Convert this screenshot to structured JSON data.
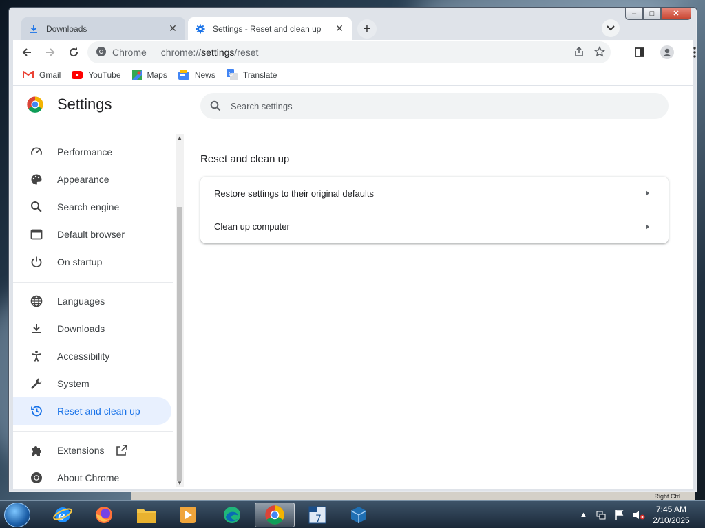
{
  "window": {
    "caption_minimize": "–",
    "caption_maximize": "□",
    "caption_close": "✕"
  },
  "tabs": [
    {
      "title": "Downloads",
      "icon": "download-icon",
      "close": "✕"
    },
    {
      "title": "Settings - Reset and clean up",
      "icon": "gear-icon",
      "close": "✕"
    }
  ],
  "new_tab": "+",
  "toolbar": {
    "site_label": "Chrome",
    "url_host": "chrome://",
    "url_path": "settings",
    "url_rest": "/reset"
  },
  "bookmarks": [
    {
      "label": "Gmail",
      "icon": "gmail-icon",
      "color": "#ea4335"
    },
    {
      "label": "YouTube",
      "icon": "youtube-icon",
      "color": "#ff0000"
    },
    {
      "label": "Maps",
      "icon": "maps-icon",
      "color": "#34a853"
    },
    {
      "label": "News",
      "icon": "news-icon",
      "color": "#4285f4"
    },
    {
      "label": "Translate",
      "icon": "translate-icon",
      "color": "#4285f4"
    }
  ],
  "settings": {
    "title": "Settings",
    "search_placeholder": "Search settings"
  },
  "sidebar": {
    "items": [
      {
        "label": "Performance",
        "icon": "speedometer-icon"
      },
      {
        "label": "Appearance",
        "icon": "palette-icon"
      },
      {
        "label": "Search engine",
        "icon": "search-icon"
      },
      {
        "label": "Default browser",
        "icon": "browser-window-icon"
      },
      {
        "label": "On startup",
        "icon": "power-icon"
      },
      {
        "label": "Languages",
        "icon": "globe-icon"
      },
      {
        "label": "Downloads",
        "icon": "download-icon"
      },
      {
        "label": "Accessibility",
        "icon": "accessibility-icon"
      },
      {
        "label": "System",
        "icon": "wrench-icon"
      },
      {
        "label": "Reset and clean up",
        "icon": "history-icon",
        "selected": true
      },
      {
        "label": "Extensions",
        "icon": "puzzle-icon"
      },
      {
        "label": "About Chrome",
        "icon": "chrome-icon"
      }
    ]
  },
  "main": {
    "section_title": "Reset and clean up",
    "rows": [
      {
        "label": "Restore settings to their original defaults"
      },
      {
        "label": "Clean up computer"
      }
    ]
  },
  "vbox_status": "Right Ctrl",
  "taskbar": {
    "apps": [
      "internet-explorer-icon",
      "firefox-icon",
      "file-explorer-icon",
      "media-player-icon",
      "edge-icon",
      "chrome-icon",
      "windows-7-icon",
      "virtualbox-icon"
    ],
    "time": "7:45 AM",
    "date": "2/10/2025",
    "accent": "#1a73e8"
  }
}
